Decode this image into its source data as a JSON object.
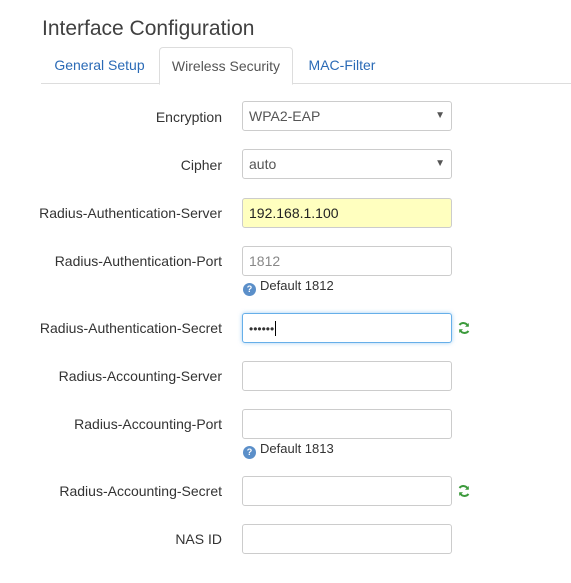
{
  "page": {
    "title": "Interface Configuration"
  },
  "tabs": [
    {
      "label": "General Setup",
      "active": false
    },
    {
      "label": "Wireless Security",
      "active": true
    },
    {
      "label": "MAC-Filter",
      "active": false
    }
  ],
  "form": {
    "encryption": {
      "label": "Encryption",
      "value": "WPA2-EAP"
    },
    "cipher": {
      "label": "Cipher",
      "value": "auto"
    },
    "radius_auth_server": {
      "label": "Radius-Authentication-Server",
      "value": "192.168.1.100"
    },
    "radius_auth_port": {
      "label": "Radius-Authentication-Port",
      "placeholder": "1812",
      "hint": "Default 1812"
    },
    "radius_auth_secret": {
      "label": "Radius-Authentication-Secret",
      "value": "••••••"
    },
    "radius_acct_server": {
      "label": "Radius-Accounting-Server",
      "value": ""
    },
    "radius_acct_port": {
      "label": "Radius-Accounting-Port",
      "value": "",
      "hint": "Default 1813"
    },
    "radius_acct_secret": {
      "label": "Radius-Accounting-Secret",
      "value": ""
    },
    "nas_id": {
      "label": "NAS ID",
      "value": ""
    }
  },
  "icons": {
    "select_arrow": "chevron-down-icon",
    "hint_icon": "info-icon",
    "reveal_icon": "refresh-icon"
  },
  "colors": {
    "link": "#2a6ab6",
    "highlight_field": "#ffffbf",
    "focus_border": "#66afe9",
    "reveal_icon": "#3c9a3c"
  }
}
